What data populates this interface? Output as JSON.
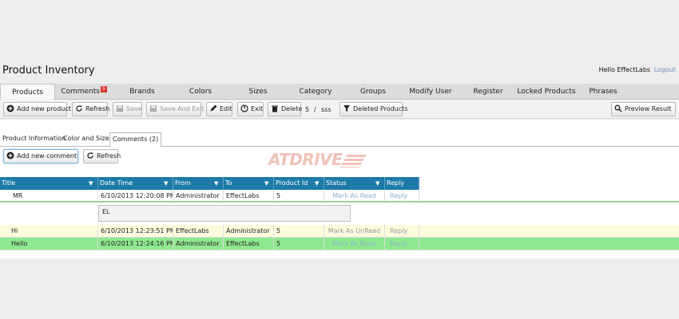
{
  "header": {
    "title": "Product Inventory",
    "hello": "Hello EffectLabs",
    "logout": "Logout"
  },
  "tabs": [
    {
      "label": "Products",
      "active": true
    },
    {
      "label": "Comments",
      "badge": "5"
    },
    {
      "label": "Brands"
    },
    {
      "label": "Colors"
    },
    {
      "label": "Sizes"
    },
    {
      "label": "Category"
    },
    {
      "label": "Groups"
    },
    {
      "label": "Modify User"
    },
    {
      "label": "Register"
    },
    {
      "label": "Locked Products"
    },
    {
      "label": "Phrases"
    }
  ],
  "toolbar": {
    "add_new_product": "Add new product",
    "refresh": "Refresh",
    "save": "Save",
    "save_and_exit": "Save And Exit",
    "edit": "Edit",
    "exit": "Exit",
    "delete": "Delete",
    "pager_current": "5",
    "pager_sep": "/",
    "pager_total": "sss",
    "deleted_products": "Deleted Products",
    "preview_result": "Preview Result"
  },
  "subtabs": [
    {
      "label": "Product Information"
    },
    {
      "label": "Color and Sizes"
    },
    {
      "label": "Comments (2)",
      "active": true
    }
  ],
  "comments_toolbar": {
    "add_new_comment": "Add new comment",
    "refresh": "Refresh"
  },
  "logo_text": "ATDRIVE",
  "grid": {
    "columns": [
      "Title",
      "Date Time",
      "From",
      "To",
      "Product Id",
      "Status",
      "Reply"
    ],
    "rows": [
      {
        "title": "MR",
        "datetime": "6/10/2013 12:20:08 PM",
        "from": "Administrator",
        "to": "EffectLabs",
        "product_id": "5",
        "status": "Mark As Read",
        "reply": "Reply",
        "detail": "EL"
      },
      {
        "title": "Hi",
        "datetime": "6/10/2013 12:23:51 PM",
        "from": "EffectLabs",
        "to": "Administrator",
        "product_id": "5",
        "status": "Mark As UnRead",
        "reply": "Reply"
      },
      {
        "title": "Hello",
        "datetime": "6/10/2013 12:24:16 PM",
        "from": "Administrator",
        "to": "EffectLabs",
        "product_id": "5",
        "status": "Mark As Read",
        "reply": "Reply"
      }
    ]
  },
  "colors": {
    "grid_header": "#1d7aa7",
    "row_unread": "#fdfbdc",
    "row_selected": "#8fe88f",
    "badge": "#d9362b"
  }
}
